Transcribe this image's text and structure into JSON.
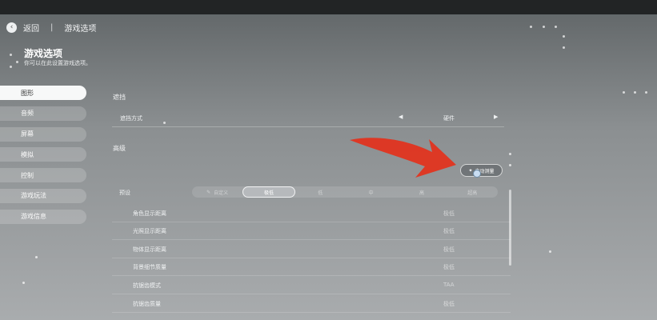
{
  "header": {
    "back_label": "返回",
    "breadcrumb": "游戏选项"
  },
  "page": {
    "title": "游戏选项",
    "subtitle": "你可以在此设置游戏选项。"
  },
  "sidebar": {
    "items": [
      {
        "label": "图形",
        "active": true
      },
      {
        "label": "音频"
      },
      {
        "label": "屏幕"
      },
      {
        "label": "模拟"
      },
      {
        "label": "控制"
      },
      {
        "label": "游戏玩法"
      },
      {
        "label": "游戏信息"
      }
    ]
  },
  "sections": {
    "occlusion": {
      "title": "遮挡",
      "method_label": "遮挡方式",
      "method_value": "硬件"
    },
    "advanced": {
      "title": "高级",
      "auto_detect": "自动测量"
    }
  },
  "preset": {
    "label": "预设",
    "options": [
      "自定义",
      "极低",
      "低",
      "中",
      "高",
      "超高"
    ],
    "selected_index": 1
  },
  "settings": [
    {
      "label": "角色显示距离",
      "value": "极低"
    },
    {
      "label": "光照显示距离",
      "value": "极低"
    },
    {
      "label": "物体显示距离",
      "value": "极低"
    },
    {
      "label": "背景细节质量",
      "value": "极低"
    },
    {
      "label": "抗锯齿模式",
      "value": "TAA"
    },
    {
      "label": "抗锯齿质量",
      "value": "极低"
    }
  ]
}
